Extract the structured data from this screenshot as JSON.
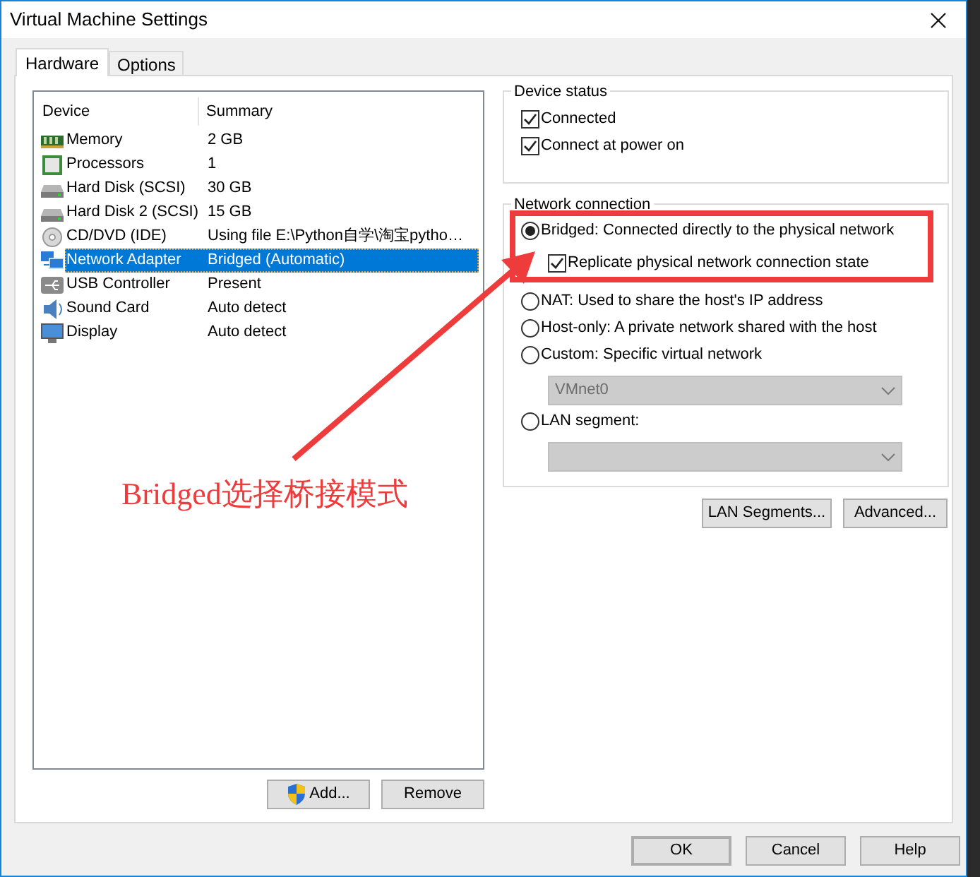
{
  "window": {
    "title": "Virtual Machine Settings"
  },
  "tabs": [
    {
      "label": "Hardware",
      "selected": true
    },
    {
      "label": "Options",
      "selected": false
    }
  ],
  "device_list": {
    "columns": [
      "Device",
      "Summary"
    ],
    "rows": [
      {
        "kind": "memory",
        "device": "Memory",
        "summary": "2 GB",
        "selected": false
      },
      {
        "kind": "processor",
        "device": "Processors",
        "summary": "1",
        "selected": false
      },
      {
        "kind": "disk",
        "device": "Hard Disk (SCSI)",
        "summary": "30 GB",
        "selected": false
      },
      {
        "kind": "disk",
        "device": "Hard Disk 2 (SCSI)",
        "summary": "15 GB",
        "selected": false
      },
      {
        "kind": "cd",
        "device": "CD/DVD (IDE)",
        "summary": "Using file E:\\Python自学\\淘宝pytho…",
        "selected": false
      },
      {
        "kind": "network",
        "device": "Network Adapter",
        "summary": "Bridged (Automatic)",
        "selected": true
      },
      {
        "kind": "usb",
        "device": "USB Controller",
        "summary": "Present",
        "selected": false
      },
      {
        "kind": "sound",
        "device": "Sound Card",
        "summary": "Auto detect",
        "selected": false
      },
      {
        "kind": "display",
        "device": "Display",
        "summary": "Auto detect",
        "selected": false
      }
    ]
  },
  "list_buttons": [
    "Add...",
    "Remove"
  ],
  "device_status": {
    "title": "Device status",
    "checkboxes": [
      {
        "label": "Connected",
        "checked": true
      },
      {
        "label": "Connect at power on",
        "checked": true
      }
    ]
  },
  "network_connection": {
    "title": "Network connection",
    "options": [
      {
        "label": "Bridged: Connected directly to the physical network",
        "selected": true,
        "sub_option": {
          "label": "Replicate physical network connection state",
          "checked": true
        }
      },
      {
        "label": "NAT: Used to share the host's IP address",
        "selected": false
      },
      {
        "label": "Host-only: A private network shared with the host",
        "selected": false
      },
      {
        "label": "Custom: Specific virtual network",
        "selected": false,
        "dropdown": {
          "value": "VMnet0",
          "disabled": true
        }
      },
      {
        "label": "LAN segment:",
        "selected": false,
        "dropdown": {
          "disabled": true
        }
      }
    ]
  },
  "network_buttons": [
    "LAN Segments...",
    "Advanced..."
  ],
  "dialog_buttons": [
    {
      "label": "OK",
      "default": true
    },
    {
      "label": "Cancel",
      "default": false
    },
    {
      "label": "Help",
      "default": false
    }
  ],
  "annotation": {
    "text": "Bridged选择桥接模式"
  }
}
